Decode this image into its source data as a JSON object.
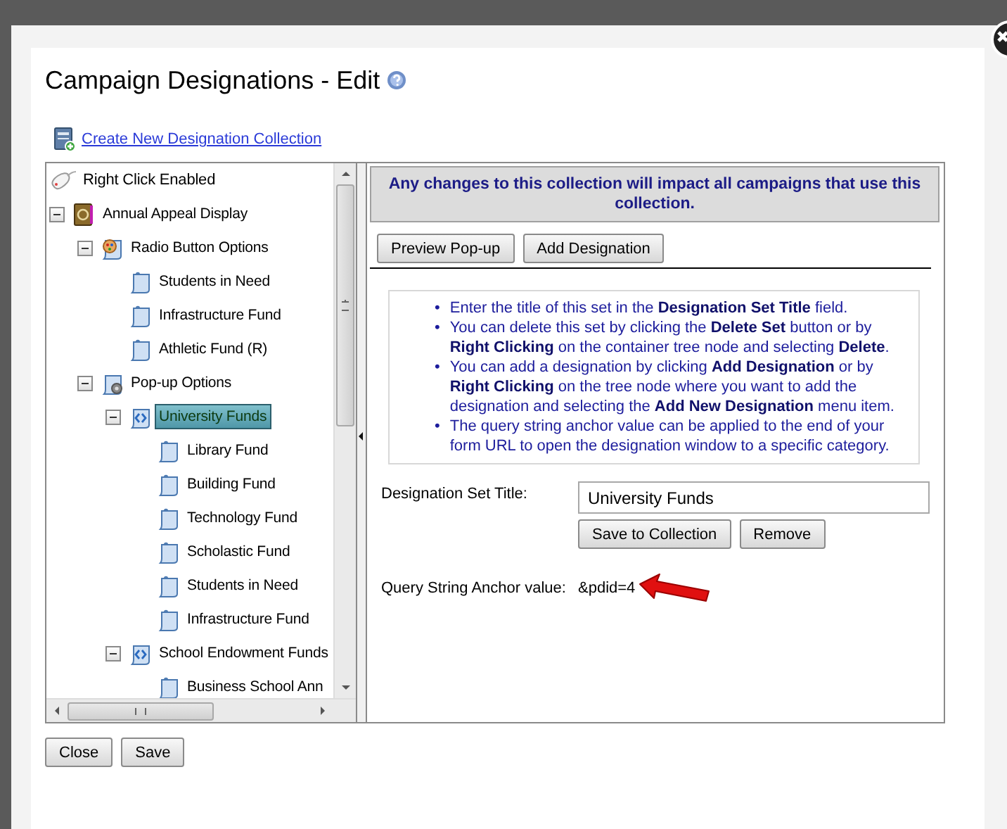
{
  "dialog": {
    "title": "Campaign Designations - Edit",
    "create_link": "Create New Designation Collection"
  },
  "tree": {
    "note": "Right Click Enabled",
    "items": [
      {
        "label": "Annual Appeal Display",
        "kind": "collection",
        "expanded": true,
        "selected": false,
        "children": [
          {
            "label": "Radio Button Options",
            "kind": "radio-group",
            "expanded": true,
            "selected": false,
            "children": [
              {
                "label": "Students in Need",
                "kind": "designation",
                "selected": false
              },
              {
                "label": "Infrastructure Fund",
                "kind": "designation",
                "selected": false
              },
              {
                "label": "Athletic Fund (R)",
                "kind": "designation",
                "selected": false
              }
            ]
          },
          {
            "label": "Pop-up Options",
            "kind": "popup-group",
            "expanded": true,
            "selected": false,
            "children": [
              {
                "label": "University Funds",
                "kind": "category",
                "expanded": true,
                "selected": true,
                "children": [
                  {
                    "label": "Library Fund",
                    "kind": "designation",
                    "selected": false
                  },
                  {
                    "label": "Building Fund",
                    "kind": "designation",
                    "selected": false
                  },
                  {
                    "label": "Technology Fund",
                    "kind": "designation",
                    "selected": false
                  },
                  {
                    "label": "Scholastic Fund",
                    "kind": "designation",
                    "selected": false
                  },
                  {
                    "label": "Students in Need",
                    "kind": "designation",
                    "selected": false
                  },
                  {
                    "label": "Infrastructure Fund",
                    "kind": "designation",
                    "selected": false
                  }
                ]
              },
              {
                "label": "School Endowment Funds",
                "kind": "category",
                "expanded": true,
                "selected": false,
                "children": [
                  {
                    "label": "Business School Ann",
                    "kind": "designation",
                    "selected": false
                  }
                ]
              }
            ]
          }
        ]
      }
    ]
  },
  "notice": "Any changes to this collection will impact all campaigns that use this collection.",
  "toolbar": [
    "Preview Pop-up",
    "Add Designation"
  ],
  "instructions": [
    {
      "bullet": "•",
      "text": "Enter the title of this set in the **Designation Set Title** field."
    },
    {
      "bullet": "•",
      "text": "You can delete this set by clicking the **Delete Set** button or by **Right Clicking** on the container tree node and selecting **Delete**."
    },
    {
      "bullet": "•",
      "text": "You can add a designation by clicking **Add Designation** or by **Right Clicking** on the tree node where you want to add the designation and selecting the **Add New Designation** menu item."
    },
    {
      "bullet": "•",
      "text": "The query string anchor value can be applied to the end of your form URL to open the designation window to a specific category."
    }
  ],
  "form": {
    "label": "Designation Set Title:",
    "value": "University Funds",
    "buttons": [
      "Save to Collection",
      "Remove"
    ]
  },
  "anchor": {
    "label": "Query String Anchor value:",
    "value": "&pdid=4"
  },
  "footer_buttons": [
    "Close",
    "Save"
  ]
}
